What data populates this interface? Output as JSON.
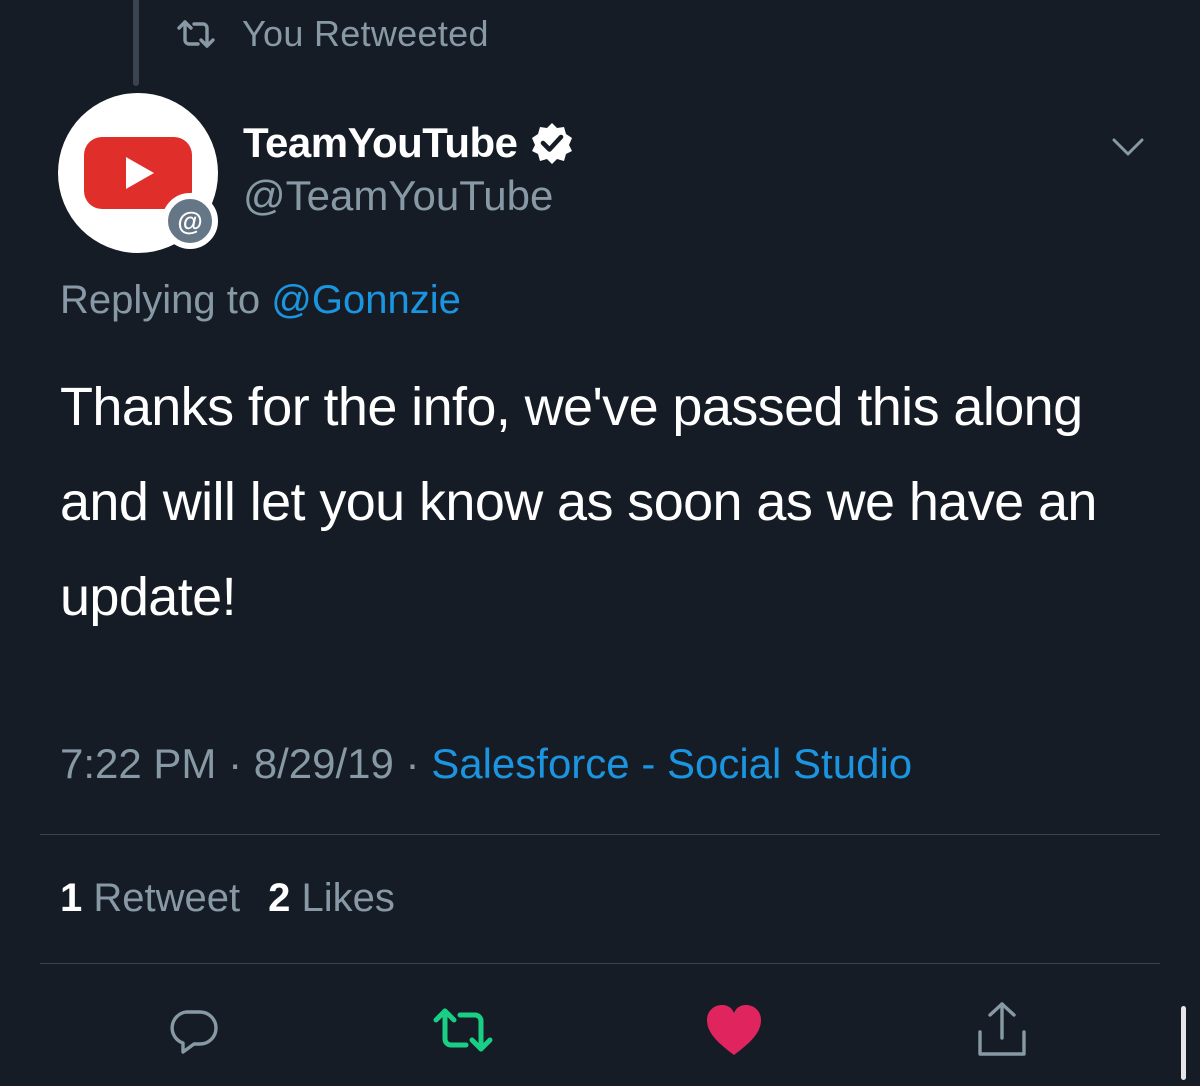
{
  "retweet_context": {
    "label": "You Retweeted",
    "icon": "retweet-icon"
  },
  "author": {
    "display_name": "TeamYouTube",
    "handle": "@TeamYouTube",
    "verified": true,
    "avatar": {
      "logo": "youtube-play-logo",
      "badge": "@"
    }
  },
  "reply": {
    "prefix": "Replying to",
    "mention": "@Gonnzie"
  },
  "tweet": {
    "text": "Thanks for the info, we've passed this along and will let you know as soon as we have an update!"
  },
  "meta": {
    "time": "7:22 PM",
    "separator": " · ",
    "date": "8/29/19",
    "source": "Salesforce - Social Studio"
  },
  "stats": {
    "retweets": {
      "count": "1",
      "label": "Retweet"
    },
    "likes": {
      "count": "2",
      "label": "Likes"
    }
  },
  "actions": [
    {
      "name": "reply",
      "icon": "comment-icon"
    },
    {
      "name": "retweet",
      "icon": "retweet-icon",
      "active": true
    },
    {
      "name": "like",
      "icon": "heart-icon",
      "active": true
    },
    {
      "name": "share",
      "icon": "share-icon"
    }
  ],
  "colors": {
    "background": "#161c26",
    "text": "#ffffff",
    "muted": "#8899a6",
    "link": "#1b95e0",
    "retweet_active": "#19cf86",
    "like_active": "#e0245e",
    "youtube_red": "#e02f2a"
  }
}
